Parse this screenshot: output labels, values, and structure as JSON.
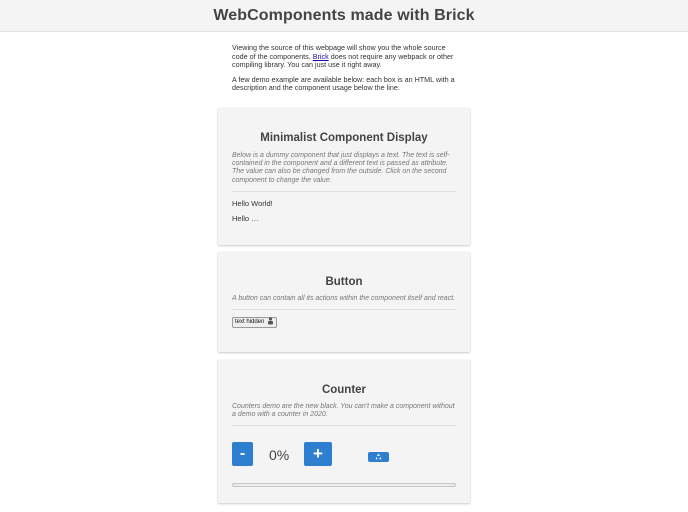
{
  "header": {
    "title": "WebComponents made with Brick"
  },
  "intro": {
    "p1_before": "Viewing the source of this webpage will show you the whole source code of the components. ",
    "p1_link": "Brick",
    "p1_after": " does not require any webpack or other compiling library. You can just use it right away.",
    "p2": "A few demo example are available below: each box is an HTML with a description and the component usage below the line."
  },
  "cards": {
    "display": {
      "title": "Minimalist Component Display",
      "description": "Below is a dummy component that just displays a text. The text is self-contained in the component and a different text is passed as attribute. The value can also be changed from the outside. Click on the second component to change the value.",
      "hello1": "Hello World!",
      "hello2": "Hello …"
    },
    "button": {
      "title": "Button",
      "description": "A button can contain all its actions within the component itself and react.",
      "button_label": "text hidden",
      "button_icon": "user-icon"
    },
    "counter": {
      "title": "Counter",
      "description": "Counters demo are the new black. You can't make a component without a demo with a counter in 2020.",
      "minus_label": "-",
      "plus_label": "+",
      "value": "0%",
      "reset_icon": "recycle-icon",
      "progress": 0
    }
  },
  "colors": {
    "accent": "#2f7fd0",
    "card_bg": "#f4f4f4"
  }
}
